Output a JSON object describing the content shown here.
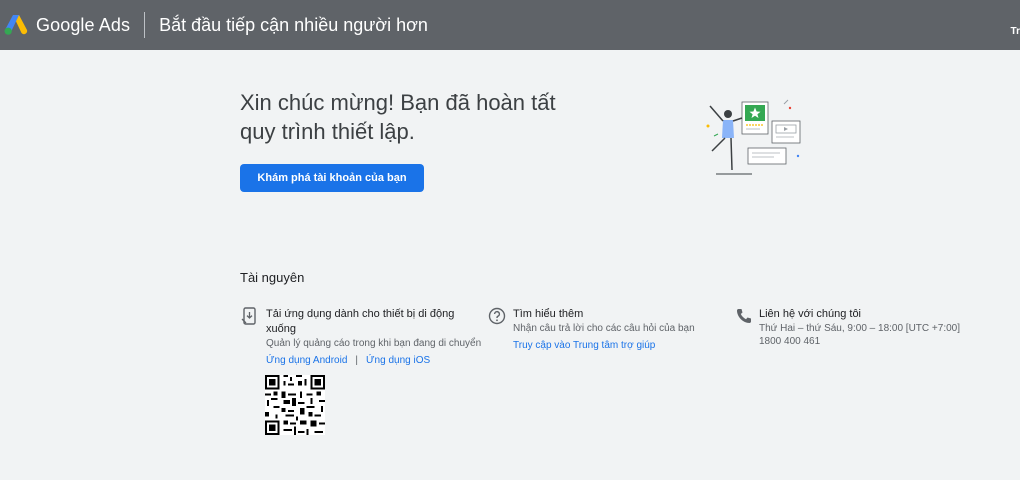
{
  "header": {
    "brand": "Google Ads",
    "title": "Bắt đầu tiếp cận nhiều người hơn",
    "right_text": "Tr"
  },
  "hero": {
    "line1": "Xin chúc mừng! Bạn đã hoàn tất",
    "line2": "quy trình thiết lập.",
    "button": "Khám phá tài khoản của bạn"
  },
  "resources": {
    "title": "Tài nguyên",
    "app": {
      "heading_line1": "Tải ứng dụng dành cho thiết bị di động",
      "heading_line2": "xuống",
      "desc": "Quản lý quảng cáo trong khi bạn đang di chuyển",
      "android": "Ứng dụng Android",
      "separator": "|",
      "ios": "Ứng dụng iOS"
    },
    "learn": {
      "heading": "Tìm hiểu thêm",
      "desc": "Nhận câu trả lời cho các câu hỏi của bạn",
      "link": "Truy cập vào Trung tâm trợ giúp"
    },
    "contact": {
      "heading": "Liên hệ với chúng tôi",
      "hours": "Thứ Hai – thứ Sáu, 9:00 – 18:00 [UTC +7:00]",
      "phone": "1800 400 461"
    }
  },
  "colors": {
    "header_bg": "#5f6368",
    "accent": "#1a73e8",
    "page_bg": "#f1f3f4"
  },
  "icons": [
    "google-ads-logo-icon",
    "phone-download-icon",
    "help-circle-icon",
    "phone-call-icon",
    "qr-code-icon"
  ]
}
